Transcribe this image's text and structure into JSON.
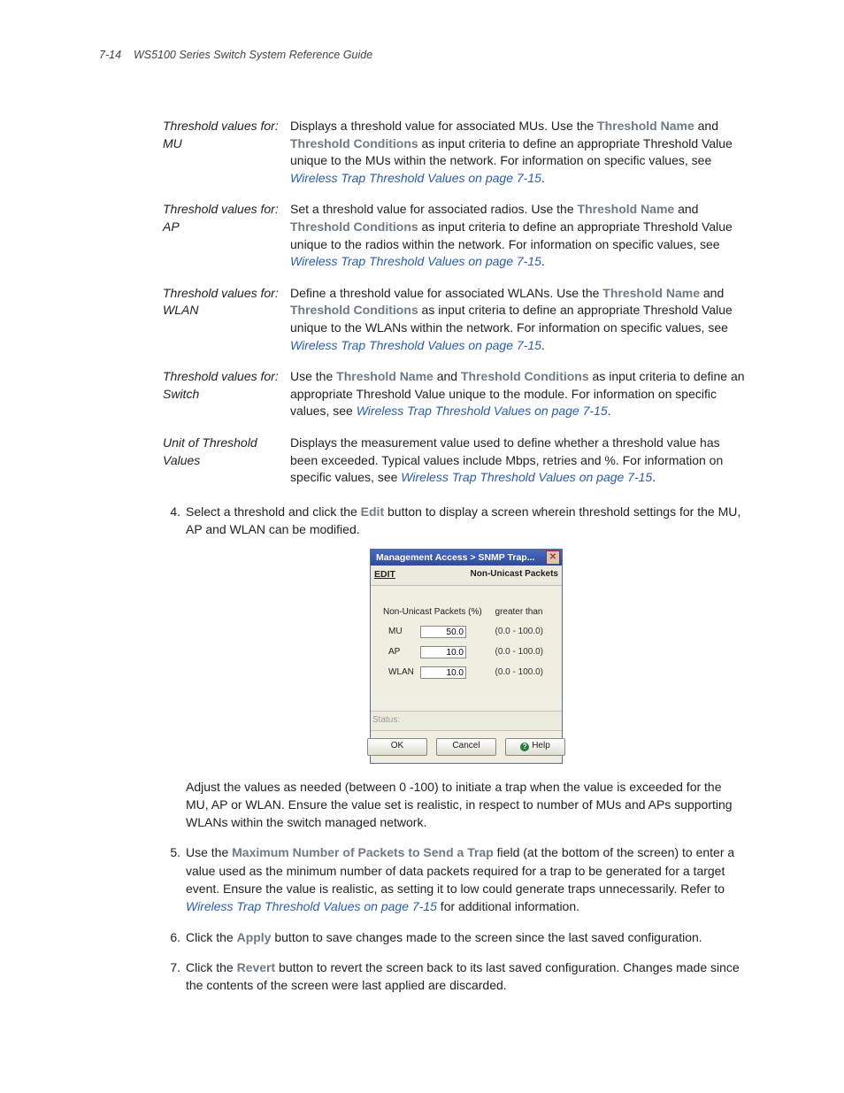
{
  "header": {
    "page_number": "7-14",
    "doc_title": "WS5100 Series Switch System Reference Guide"
  },
  "defs": [
    {
      "term": "Threshold values for: MU",
      "pre": "Displays a threshold value for associated MUs. Use the ",
      "b1": "Threshold Name",
      "mid1": " and ",
      "b2": "Threshold Conditions",
      "post1": " as input criteria to define an appropriate Threshold Value unique to the MUs within the network. For information on specific values, see ",
      "link": "Wireless Trap Threshold Values on page 7-15",
      "post2": "."
    },
    {
      "term": "Threshold values for: AP",
      "pre": "Set a threshold value for associated radios. Use the ",
      "b1": "Threshold Name",
      "mid1": " and ",
      "b2": "Threshold Conditions",
      "post1": " as input criteria to define an appropriate Threshold Value unique to the radios within the network. For information on specific values, see ",
      "link": "Wireless Trap Threshold Values on page 7-15",
      "post2": "."
    },
    {
      "term": "Threshold values for: WLAN",
      "pre": "Define a threshold value for associated WLANs. Use the ",
      "b1": "Threshold Name",
      "mid1": " and ",
      "b2": "Threshold Conditions",
      "post1": " as input criteria to define an appropriate Threshold Value unique to the WLANs within the network. For information on specific values, see ",
      "link": "Wireless Trap Threshold Values on page 7-15",
      "post2": "."
    },
    {
      "term": "Threshold values for: Switch",
      "pre": "Use the ",
      "b1": "Threshold Name",
      "mid1": " and ",
      "b2": "Threshold Conditions",
      "post1": " as input criteria to define an appropriate Threshold Value unique to the module. For information on specific values, see ",
      "link": "Wireless Trap Threshold Values on page 7-15",
      "post2": "."
    },
    {
      "term": "Unit of Threshold Values",
      "pre": "Displays the measurement value used to define whether a threshold value has been exceeded. Typical values include Mbps, retries and %. For information on specific values, see ",
      "b1": "",
      "mid1": "",
      "b2": "",
      "post1": "",
      "link": "Wireless Trap Threshold Values on page 7-15",
      "post2": "."
    }
  ],
  "steps": {
    "s4": {
      "num": "4.",
      "t1": "Select a threshold and click the ",
      "b1": "Edit",
      "t2": " button to display a screen wherein threshold settings for the MU, AP and WLAN can be modified.",
      "after": "Adjust the values as needed (between 0 -100) to initiate a trap when the value is exceeded for the MU, AP or WLAN. Ensure the value set is realistic, in respect to number of MUs and APs supporting WLANs within the switch managed network."
    },
    "s5": {
      "num": "5.",
      "t1": "Use the ",
      "b1": "Maximum Number of Packets to Send a Trap",
      "t2": " field (at the bottom of the screen) to enter a value used as the minimum number of data packets required for a trap to be generated for a target event. Ensure the value is realistic, as setting it to low could generate traps unnecessarily. Refer to ",
      "link": "Wireless Trap Threshold Values on page 7-15",
      "t3": " for additional information."
    },
    "s6": {
      "num": "6.",
      "t1": "Click the ",
      "b1": "Apply",
      "t2": " button to save changes made to the screen since the last saved configuration."
    },
    "s7": {
      "num": "7.",
      "t1": "Click the ",
      "b1": "Revert",
      "t2": " button to revert the screen back to its last saved configuration. Changes made since the contents of the screen were last applied are discarded."
    }
  },
  "dialog": {
    "title": "Management Access > SNMP Trap...",
    "edit": "EDIT",
    "subtitle": "Non-Unicast Packets",
    "col1": "Non-Unicast Packets (%)",
    "col2": "greater than",
    "rows": [
      {
        "label": "MU",
        "value": "50.0",
        "range": "(0.0 - 100.0)"
      },
      {
        "label": "AP",
        "value": "10.0",
        "range": "(0.0 - 100.0)"
      },
      {
        "label": "WLAN",
        "value": "10.0",
        "range": "(0.0 - 100.0)"
      }
    ],
    "status": "Status:",
    "ok": "OK",
    "cancel": "Cancel",
    "help": "Help"
  }
}
